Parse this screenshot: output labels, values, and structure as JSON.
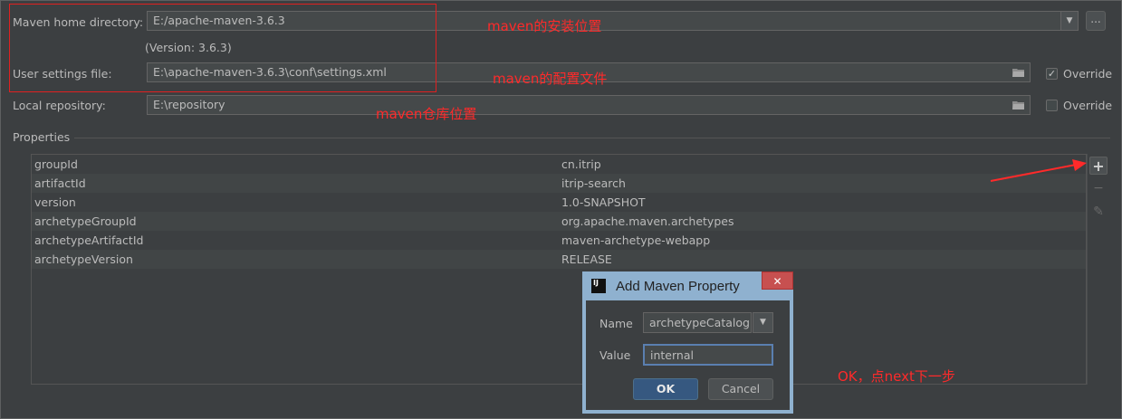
{
  "maven": {
    "home_label": "Maven home directory:",
    "home_value": "E:/apache-maven-3.6.3",
    "version_text": "(Version: 3.6.3)",
    "settings_label": "User settings file:",
    "settings_value": "E:\\apache-maven-3.6.3\\conf\\settings.xml",
    "settings_override_label": "Override",
    "settings_override_checked": true,
    "repo_label": "Local repository:",
    "repo_value": "E:\\repository",
    "repo_override_label": "Override",
    "repo_override_checked": false,
    "browse_label": "..."
  },
  "properties": {
    "section_label": "Properties",
    "rows": [
      {
        "key": "groupId",
        "value": "cn.itrip"
      },
      {
        "key": "artifactId",
        "value": "itrip-search"
      },
      {
        "key": "version",
        "value": "1.0-SNAPSHOT"
      },
      {
        "key": "archetypeGroupId",
        "value": "org.apache.maven.archetypes"
      },
      {
        "key": "archetypeArtifactId",
        "value": "maven-archetype-webapp"
      },
      {
        "key": "archetypeVersion",
        "value": "RELEASE"
      }
    ]
  },
  "annotations": {
    "home_note": "maven的安装位置",
    "settings_note": "maven的配置文件",
    "repo_note": "maven仓库位置",
    "ok_note": "OK，点next下一步"
  },
  "dialog": {
    "logo_text": "IJ",
    "title": "Add Maven Property",
    "name_label": "Name",
    "name_value": "archetypeCatalog",
    "value_label": "Value",
    "value_value": "internal",
    "ok_label": "OK",
    "cancel_label": "Cancel",
    "close_glyph": "✕"
  },
  "icons": {
    "add": "+",
    "remove": "−",
    "edit": "✎",
    "dropdown": "▼",
    "check": "✓"
  },
  "colors": {
    "background": "#3c3f41",
    "annotation_red": "#ff2a2a",
    "dialog_border": "#8fb1cf",
    "ok_button": "#365880"
  }
}
